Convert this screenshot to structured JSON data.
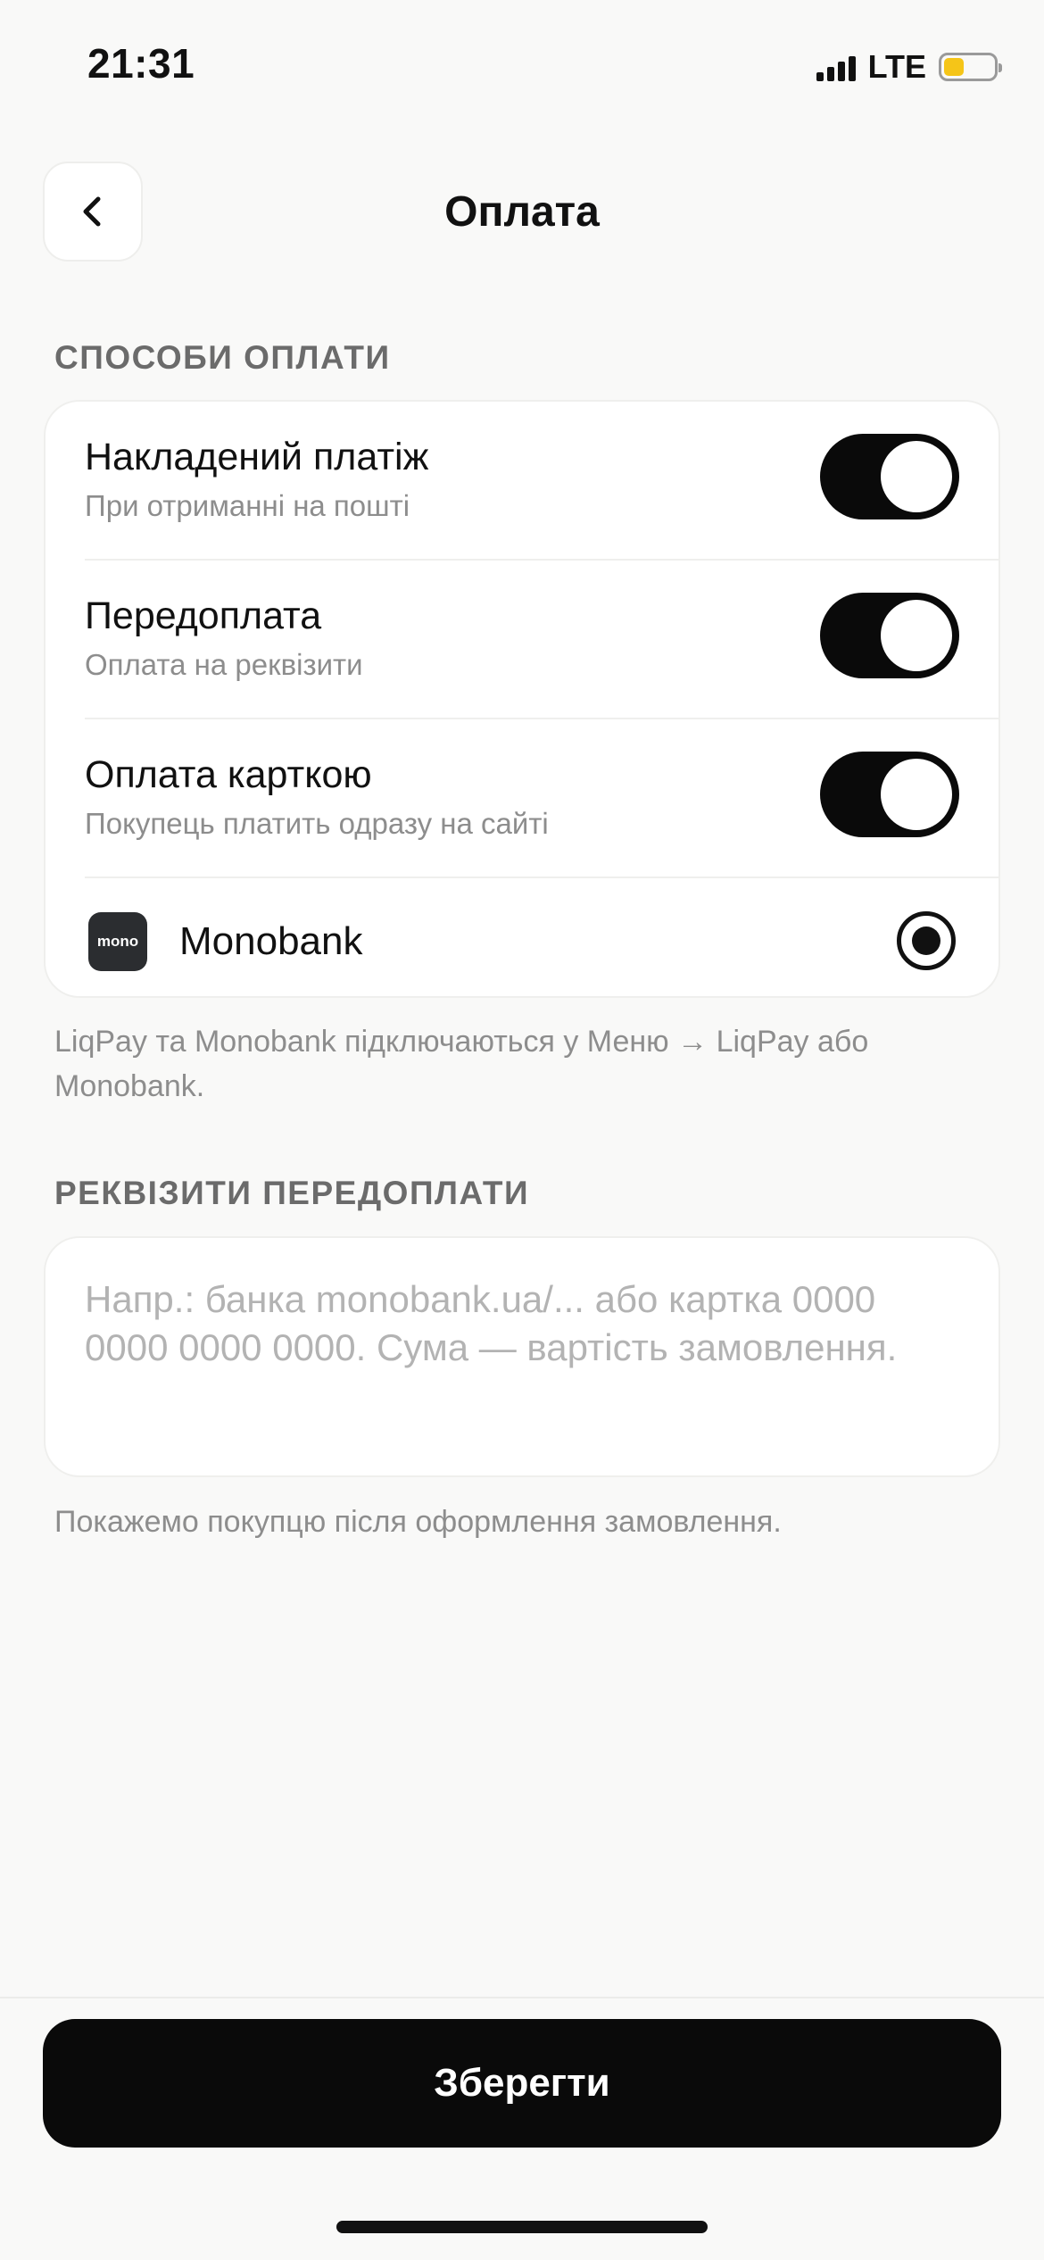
{
  "status_bar": {
    "time": "21:31",
    "network": "LTE",
    "signal_icon": "signal-bars-icon",
    "battery_icon": "battery-low-icon",
    "battery_color": "#f5c518"
  },
  "header": {
    "back_icon": "chevron-left-icon",
    "title": "Оплата"
  },
  "payment_methods": {
    "section_label": "СПОСОБИ ОПЛАТИ",
    "items": [
      {
        "title": "Накладений платіж",
        "subtitle": "При отриманні на пошті",
        "enabled": true
      },
      {
        "title": "Передоплата",
        "subtitle": "Оплата на реквізити",
        "enabled": true
      },
      {
        "title": "Оплата карткою",
        "subtitle": "Покупець платить одразу на сайті",
        "enabled": true
      }
    ],
    "provider": {
      "logo_text": "mono",
      "label": "Monobank",
      "selected": true
    },
    "hint": "LiqPay та Monobank підключаються у Меню → LiqPay або Monobank."
  },
  "prepayment_details": {
    "section_label": "РЕКВІЗИТИ ПЕРЕДОПЛАТИ",
    "value": "",
    "placeholder": "Напр.: банка monobank.ua/... або картка 0000 0000 0000 0000. Сума — вартість замовлення.",
    "hint": "Покажемо покупцю після оформлення замовлення."
  },
  "footer": {
    "save_label": "Зберегти"
  },
  "colors": {
    "background": "#f9f9f8",
    "accent": "#0a0a0a",
    "muted_text": "#8d8d8d"
  }
}
